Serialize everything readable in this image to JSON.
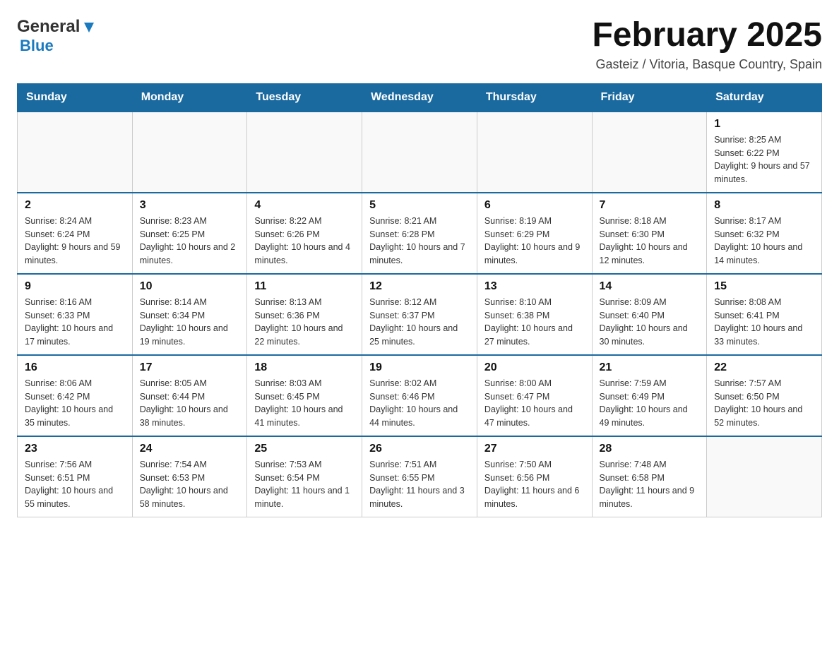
{
  "header": {
    "logo_general": "General",
    "logo_blue": "Blue",
    "month_title": "February 2025",
    "subtitle": "Gasteiz / Vitoria, Basque Country, Spain"
  },
  "days_of_week": [
    "Sunday",
    "Monday",
    "Tuesday",
    "Wednesday",
    "Thursday",
    "Friday",
    "Saturday"
  ],
  "weeks": [
    [
      {
        "day": "",
        "info": ""
      },
      {
        "day": "",
        "info": ""
      },
      {
        "day": "",
        "info": ""
      },
      {
        "day": "",
        "info": ""
      },
      {
        "day": "",
        "info": ""
      },
      {
        "day": "",
        "info": ""
      },
      {
        "day": "1",
        "info": "Sunrise: 8:25 AM\nSunset: 6:22 PM\nDaylight: 9 hours and 57 minutes."
      }
    ],
    [
      {
        "day": "2",
        "info": "Sunrise: 8:24 AM\nSunset: 6:24 PM\nDaylight: 9 hours and 59 minutes."
      },
      {
        "day": "3",
        "info": "Sunrise: 8:23 AM\nSunset: 6:25 PM\nDaylight: 10 hours and 2 minutes."
      },
      {
        "day": "4",
        "info": "Sunrise: 8:22 AM\nSunset: 6:26 PM\nDaylight: 10 hours and 4 minutes."
      },
      {
        "day": "5",
        "info": "Sunrise: 8:21 AM\nSunset: 6:28 PM\nDaylight: 10 hours and 7 minutes."
      },
      {
        "day": "6",
        "info": "Sunrise: 8:19 AM\nSunset: 6:29 PM\nDaylight: 10 hours and 9 minutes."
      },
      {
        "day": "7",
        "info": "Sunrise: 8:18 AM\nSunset: 6:30 PM\nDaylight: 10 hours and 12 minutes."
      },
      {
        "day": "8",
        "info": "Sunrise: 8:17 AM\nSunset: 6:32 PM\nDaylight: 10 hours and 14 minutes."
      }
    ],
    [
      {
        "day": "9",
        "info": "Sunrise: 8:16 AM\nSunset: 6:33 PM\nDaylight: 10 hours and 17 minutes."
      },
      {
        "day": "10",
        "info": "Sunrise: 8:14 AM\nSunset: 6:34 PM\nDaylight: 10 hours and 19 minutes."
      },
      {
        "day": "11",
        "info": "Sunrise: 8:13 AM\nSunset: 6:36 PM\nDaylight: 10 hours and 22 minutes."
      },
      {
        "day": "12",
        "info": "Sunrise: 8:12 AM\nSunset: 6:37 PM\nDaylight: 10 hours and 25 minutes."
      },
      {
        "day": "13",
        "info": "Sunrise: 8:10 AM\nSunset: 6:38 PM\nDaylight: 10 hours and 27 minutes."
      },
      {
        "day": "14",
        "info": "Sunrise: 8:09 AM\nSunset: 6:40 PM\nDaylight: 10 hours and 30 minutes."
      },
      {
        "day": "15",
        "info": "Sunrise: 8:08 AM\nSunset: 6:41 PM\nDaylight: 10 hours and 33 minutes."
      }
    ],
    [
      {
        "day": "16",
        "info": "Sunrise: 8:06 AM\nSunset: 6:42 PM\nDaylight: 10 hours and 35 minutes."
      },
      {
        "day": "17",
        "info": "Sunrise: 8:05 AM\nSunset: 6:44 PM\nDaylight: 10 hours and 38 minutes."
      },
      {
        "day": "18",
        "info": "Sunrise: 8:03 AM\nSunset: 6:45 PM\nDaylight: 10 hours and 41 minutes."
      },
      {
        "day": "19",
        "info": "Sunrise: 8:02 AM\nSunset: 6:46 PM\nDaylight: 10 hours and 44 minutes."
      },
      {
        "day": "20",
        "info": "Sunrise: 8:00 AM\nSunset: 6:47 PM\nDaylight: 10 hours and 47 minutes."
      },
      {
        "day": "21",
        "info": "Sunrise: 7:59 AM\nSunset: 6:49 PM\nDaylight: 10 hours and 49 minutes."
      },
      {
        "day": "22",
        "info": "Sunrise: 7:57 AM\nSunset: 6:50 PM\nDaylight: 10 hours and 52 minutes."
      }
    ],
    [
      {
        "day": "23",
        "info": "Sunrise: 7:56 AM\nSunset: 6:51 PM\nDaylight: 10 hours and 55 minutes."
      },
      {
        "day": "24",
        "info": "Sunrise: 7:54 AM\nSunset: 6:53 PM\nDaylight: 10 hours and 58 minutes."
      },
      {
        "day": "25",
        "info": "Sunrise: 7:53 AM\nSunset: 6:54 PM\nDaylight: 11 hours and 1 minute."
      },
      {
        "day": "26",
        "info": "Sunrise: 7:51 AM\nSunset: 6:55 PM\nDaylight: 11 hours and 3 minutes."
      },
      {
        "day": "27",
        "info": "Sunrise: 7:50 AM\nSunset: 6:56 PM\nDaylight: 11 hours and 6 minutes."
      },
      {
        "day": "28",
        "info": "Sunrise: 7:48 AM\nSunset: 6:58 PM\nDaylight: 11 hours and 9 minutes."
      },
      {
        "day": "",
        "info": ""
      }
    ]
  ]
}
